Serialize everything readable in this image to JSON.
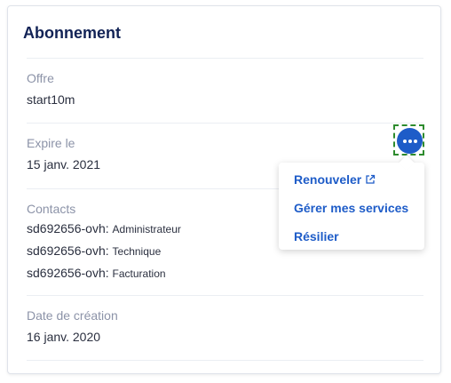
{
  "card": {
    "title": "Abonnement",
    "offer": {
      "label": "Offre",
      "value": "start10m"
    },
    "expiry": {
      "label": "Expire le",
      "value": "15 janv. 2021"
    },
    "contacts": {
      "label": "Contacts",
      "items": [
        {
          "account": "sd692656-ovh:",
          "role": "Administrateur"
        },
        {
          "account": "sd692656-ovh:",
          "role": "Technique"
        },
        {
          "account": "sd692656-ovh:",
          "role": "Facturation"
        }
      ]
    },
    "creation": {
      "label": "Date de création",
      "value": "16 janv. 2020"
    }
  },
  "actions_menu": {
    "button_icon": "more-horizontal-icon",
    "items": [
      {
        "label": "Renouveler",
        "icon": "external-link-icon"
      },
      {
        "label": "Gérer mes services"
      },
      {
        "label": "Résilier"
      }
    ]
  },
  "colors": {
    "title": "#122356",
    "accent": "#1e5cc8",
    "label": "#8c93a8",
    "text": "#2a2f3f",
    "focus_outline": "#2e8b2e"
  }
}
